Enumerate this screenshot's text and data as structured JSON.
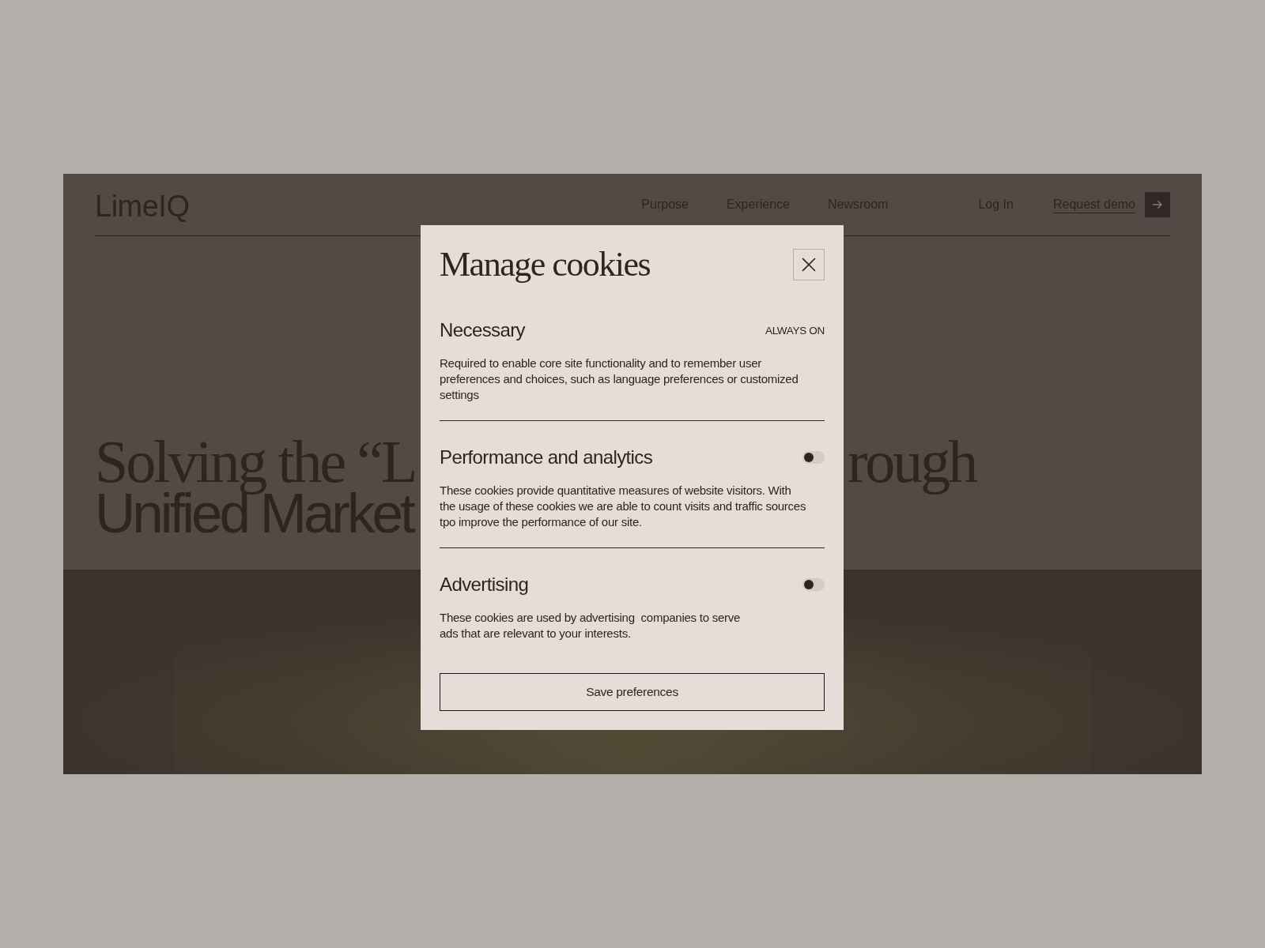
{
  "header": {
    "logo": "LimeIQ",
    "nav": [
      "Purpose",
      "Experience",
      "Newsroom"
    ],
    "login": "Log In",
    "cta": "Request demo"
  },
  "hero": {
    "headline": [
      {
        "kind": "serif",
        "left": "Solving the “L",
        "right": "rough"
      },
      {
        "kind": "sans",
        "left": "Unified Market"
      }
    ]
  },
  "modal": {
    "title": "Manage cookies",
    "sections": [
      {
        "kind": "always_on",
        "title": "Necessary",
        "status": "ALWAYS ON",
        "description": "Required to enable core site functionality and to remember user preferences and choices, such as language preferences or customized settings"
      },
      {
        "kind": "toggle",
        "title": "Performance and analytics",
        "on": false,
        "description": "These cookies provide quantitative measures of website visitors. With the usage of these cookies we are able to count visits and traffic sources tpo improve the performance of our site."
      },
      {
        "kind": "toggle",
        "title": "Advertising",
        "on": false,
        "description": "These cookies are used by advertising  companies to serve\nads that are relevant to your interests."
      }
    ],
    "button": "Save preferences"
  }
}
